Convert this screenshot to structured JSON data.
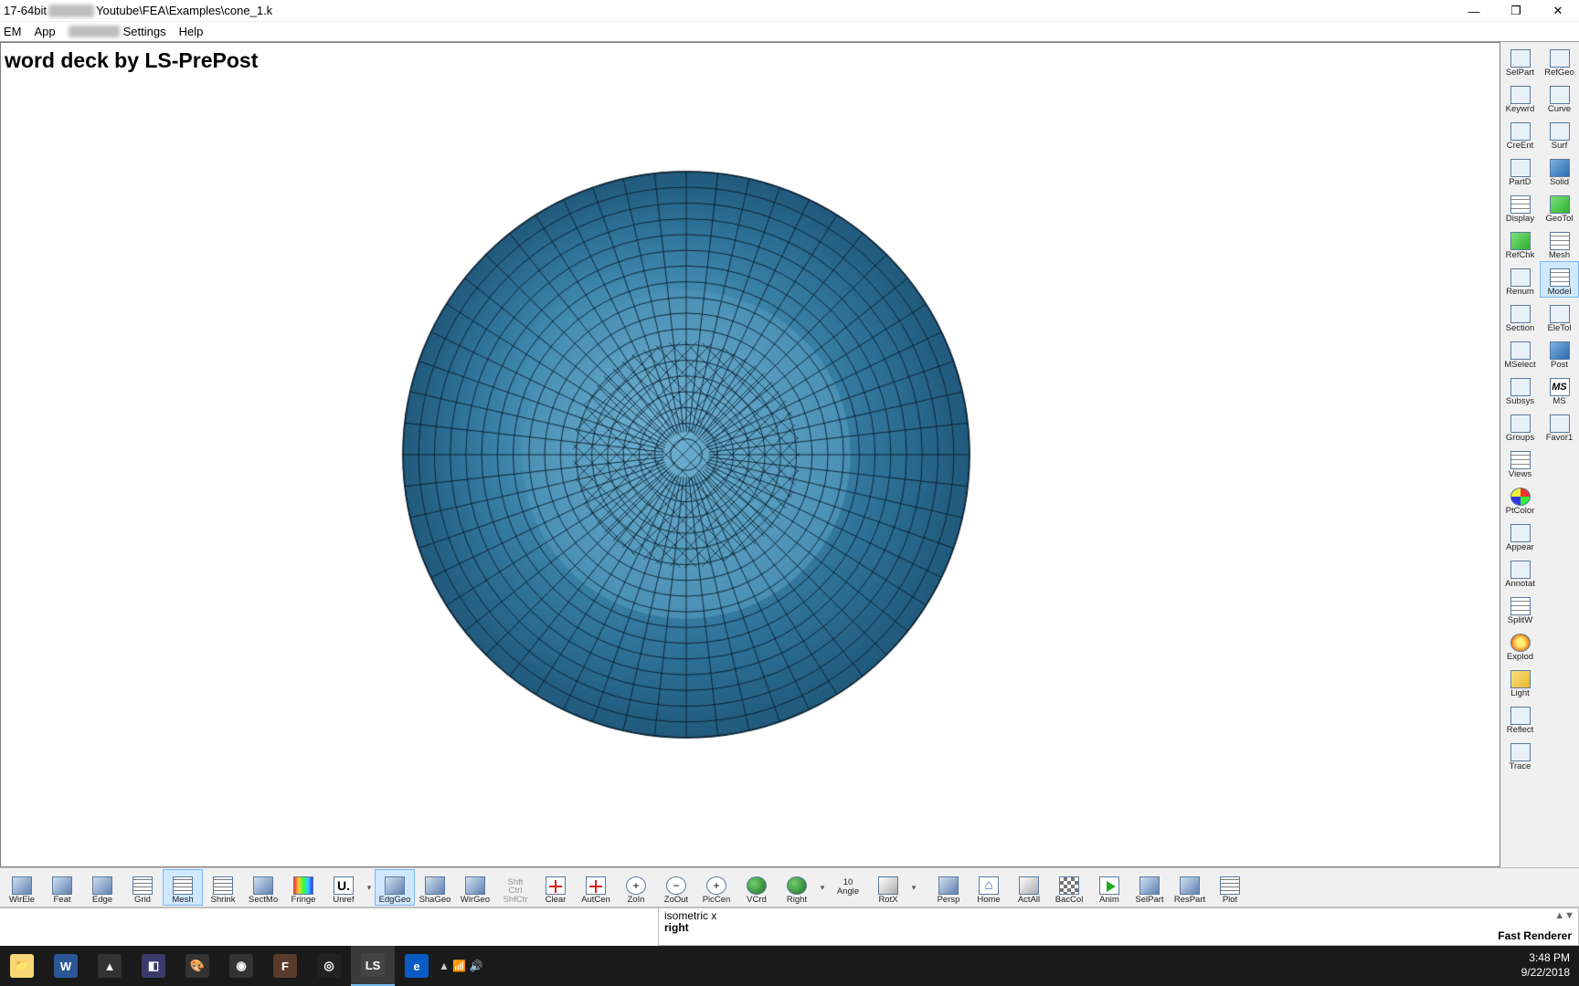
{
  "window": {
    "title_prefix": "17-64bit",
    "title_path": "Youtube\\FEA\\Examples\\cone_1.k",
    "minimize": "—",
    "maximize": "❐",
    "close": "✕"
  },
  "menu": {
    "items": [
      "EM",
      "App",
      "Settings",
      "Help"
    ]
  },
  "doc_title": "word deck by LS-PrePost",
  "side_col1": [
    {
      "id": "selpart",
      "label": "SelPart"
    },
    {
      "id": "keywrd",
      "label": "Keywrd"
    },
    {
      "id": "creent",
      "label": "CreEnt"
    },
    {
      "id": "partd",
      "label": "PartD"
    },
    {
      "id": "display",
      "label": "Display"
    },
    {
      "id": "refchk",
      "label": "RefChk"
    },
    {
      "id": "renum",
      "label": "Renum"
    },
    {
      "id": "section",
      "label": "Section"
    },
    {
      "id": "mselect",
      "label": "MSelect"
    },
    {
      "id": "subsys",
      "label": "Subsys"
    },
    {
      "id": "groups",
      "label": "Groups"
    },
    {
      "id": "views",
      "label": "Views"
    },
    {
      "id": "ptcolor",
      "label": "PtColor"
    },
    {
      "id": "appear",
      "label": "Appear"
    },
    {
      "id": "annotat",
      "label": "Annotat"
    },
    {
      "id": "splitw",
      "label": "SplitW"
    },
    {
      "id": "explod",
      "label": "Explod"
    },
    {
      "id": "light",
      "label": "Light"
    },
    {
      "id": "reflect",
      "label": "Reflect"
    },
    {
      "id": "trace",
      "label": "Trace"
    }
  ],
  "side_col2": [
    {
      "id": "refgeo",
      "label": "RefGeo"
    },
    {
      "id": "curve",
      "label": "Curve"
    },
    {
      "id": "surf",
      "label": "Surf"
    },
    {
      "id": "solid",
      "label": "Solid"
    },
    {
      "id": "geotol",
      "label": "GeoTol"
    },
    {
      "id": "mesh",
      "label": "Mesh"
    },
    {
      "id": "model",
      "label": "Model",
      "selected": true
    },
    {
      "id": "eletol",
      "label": "EleTol"
    },
    {
      "id": "post",
      "label": "Post"
    },
    {
      "id": "ms",
      "label": "MS"
    },
    {
      "id": "favor1",
      "label": "Favor1"
    }
  ],
  "bottom": [
    {
      "id": "wirele",
      "label": "WirEle",
      "cls": "cube"
    },
    {
      "id": "feat",
      "label": "Feat",
      "cls": "cube"
    },
    {
      "id": "edge",
      "label": "Edge",
      "cls": "cube"
    },
    {
      "id": "gridb",
      "label": "Grid",
      "cls": "grid"
    },
    {
      "id": "meshb",
      "label": "Mesh",
      "cls": "grid",
      "selected": true
    },
    {
      "id": "shrink",
      "label": "Shrink",
      "cls": "grid"
    },
    {
      "id": "sectmo",
      "label": "SectMo",
      "cls": "cube"
    },
    {
      "id": "fringe",
      "label": "Fringe",
      "cls": "rainbow"
    },
    {
      "id": "unref",
      "label": "Unref",
      "cls": "U"
    },
    {
      "id": "edggeo",
      "label": "EdgGeo",
      "cls": "cube",
      "selected": true
    },
    {
      "id": "shageo",
      "label": "ShaGeo",
      "cls": "cube"
    },
    {
      "id": "wirgeo",
      "label": "WirGeo",
      "cls": "cube"
    },
    {
      "id": "shfctr",
      "label": "ShfCtr",
      "disabled": true,
      "extra": "Shft Ctrl"
    },
    {
      "id": "clear",
      "label": "Clear",
      "cls": "plus"
    },
    {
      "id": "autcen",
      "label": "AutCen",
      "cls": "plus"
    },
    {
      "id": "zoin",
      "label": "ZoIn",
      "cls": "zoomin"
    },
    {
      "id": "zoout",
      "label": "ZoOut",
      "cls": "zoomout"
    },
    {
      "id": "piccen",
      "label": "PicCen",
      "cls": "zoomin"
    },
    {
      "id": "vcrd",
      "label": "VCrd",
      "cls": "globe"
    },
    {
      "id": "right",
      "label": "Right",
      "cls": "globe"
    },
    {
      "id": "angle",
      "label": "Angle",
      "num": "10"
    },
    {
      "id": "rotx",
      "label": "RotX",
      "cls": "tri"
    },
    {
      "id": "persp",
      "label": "Persp",
      "cls": "cube"
    },
    {
      "id": "homeb",
      "label": "Home",
      "cls": "home"
    },
    {
      "id": "actall",
      "label": "ActAll",
      "cls": "tri"
    },
    {
      "id": "baccol",
      "label": "BacCol",
      "cls": "checker"
    },
    {
      "id": "anim",
      "label": "Anim",
      "cls": "play"
    },
    {
      "id": "selpartb",
      "label": "SelPart",
      "cls": "cube"
    },
    {
      "id": "respart",
      "label": "ResPart",
      "cls": "cube"
    },
    {
      "id": "plot",
      "label": "Plot",
      "cls": "grid"
    }
  ],
  "cmd": {
    "line1": "isometric x",
    "line2": "right"
  },
  "status": {
    "renderer": "Fast Renderer"
  },
  "taskbar": {
    "items": [
      {
        "id": "explorer",
        "glyph": "📁",
        "color": "#f8d775"
      },
      {
        "id": "word",
        "glyph": "W",
        "color": "#2b5797"
      },
      {
        "id": "up",
        "glyph": "▲",
        "color": "#333"
      },
      {
        "id": "app1",
        "glyph": "◧",
        "color": "#3a3a6a"
      },
      {
        "id": "paint",
        "glyph": "🎨",
        "color": "#333"
      },
      {
        "id": "browser1",
        "glyph": "◉",
        "color": "#333"
      },
      {
        "id": "app2",
        "glyph": "F",
        "color": "#5a3a2a"
      },
      {
        "id": "obs",
        "glyph": "◎",
        "color": "#222"
      },
      {
        "id": "lspp",
        "glyph": "LS",
        "color": "#444",
        "active": true
      },
      {
        "id": "edge",
        "glyph": "e",
        "color": "#0a5bc4"
      }
    ],
    "time": "3:48 PM",
    "date": "9/22/2018"
  }
}
